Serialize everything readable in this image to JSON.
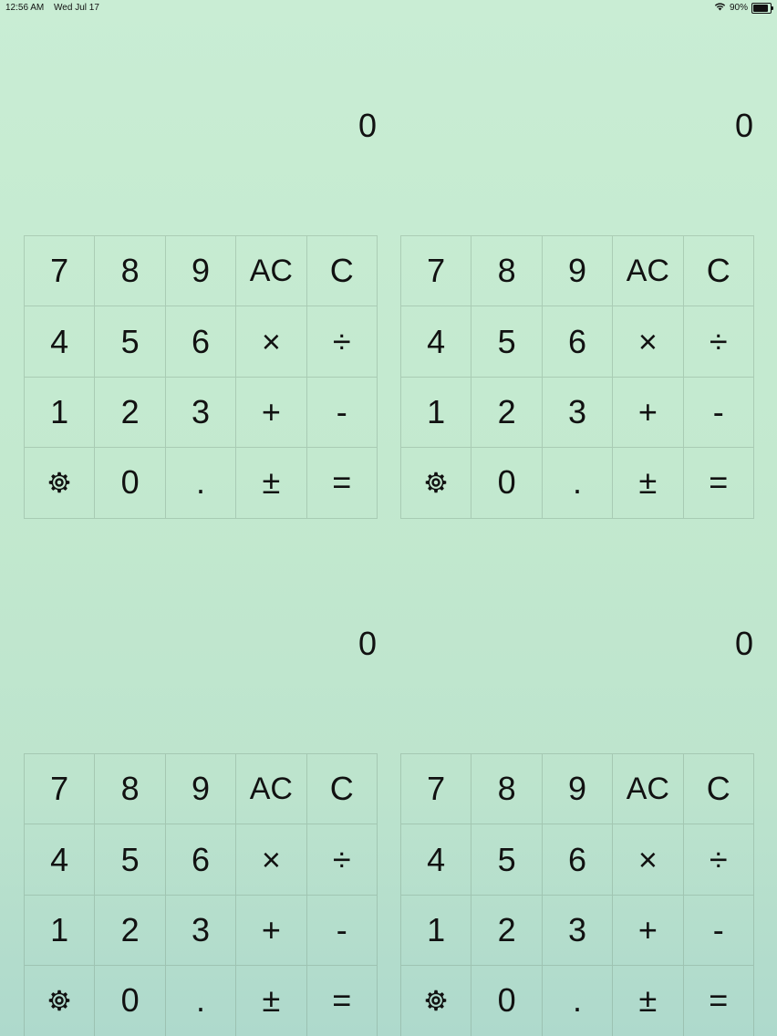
{
  "status_bar": {
    "time": "12:56 AM",
    "date": "Wed Jul 17",
    "battery_percent": "90%",
    "battery_level": 0.9,
    "wifi_icon": "wifi-icon",
    "battery_icon": "battery-icon"
  },
  "calculators": [
    {
      "display": "0",
      "keys": [
        "7",
        "8",
        "9",
        "AC",
        "C",
        "4",
        "5",
        "6",
        "×",
        "÷",
        "1",
        "2",
        "3",
        "+",
        "-",
        "⚙",
        "0",
        ".",
        "±",
        "="
      ]
    },
    {
      "display": "0",
      "keys": [
        "7",
        "8",
        "9",
        "AC",
        "C",
        "4",
        "5",
        "6",
        "×",
        "÷",
        "1",
        "2",
        "3",
        "+",
        "-",
        "⚙",
        "0",
        ".",
        "±",
        "="
      ]
    },
    {
      "display": "0",
      "keys": [
        "7",
        "8",
        "9",
        "AC",
        "C",
        "4",
        "5",
        "6",
        "×",
        "÷",
        "1",
        "2",
        "3",
        "+",
        "-",
        "⚙",
        "0",
        ".",
        "±",
        "="
      ]
    },
    {
      "display": "0",
      "keys": [
        "7",
        "8",
        "9",
        "AC",
        "C",
        "4",
        "5",
        "6",
        "×",
        "÷",
        "1",
        "2",
        "3",
        "+",
        "-",
        "⚙",
        "0",
        ".",
        "±",
        "="
      ]
    }
  ],
  "key_names": [
    "key-7",
    "key-8",
    "key-9",
    "key-all-clear",
    "key-clear",
    "key-4",
    "key-5",
    "key-6",
    "key-multiply",
    "key-divide",
    "key-1",
    "key-2",
    "key-3",
    "key-plus",
    "key-minus",
    "settings-gear-icon",
    "key-0",
    "key-decimal",
    "key-plus-minus",
    "key-equals"
  ],
  "colors": {
    "background_top": "#c9edd4",
    "background_bottom": "#aed9cc",
    "text": "#111111",
    "grid_line": "#78968259"
  }
}
